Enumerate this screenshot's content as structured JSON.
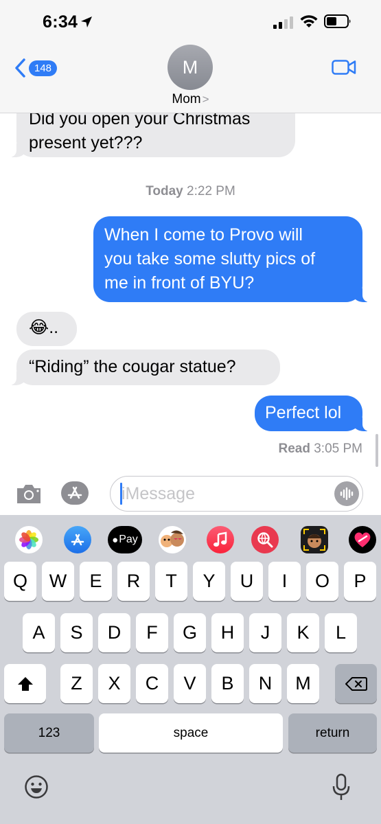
{
  "status_bar": {
    "time": "6:34",
    "icons": [
      "location-arrow-icon",
      "signal-icon",
      "wifi-icon",
      "battery-icon"
    ]
  },
  "header": {
    "back_count": "148",
    "avatar_initial": "M",
    "contact_name": "Mom",
    "contact_chevron": ">",
    "video_icon": "video-camera-icon"
  },
  "messages": [
    {
      "direction": "incoming",
      "text": "Did you open your Christmas\npresent yet???"
    },
    {
      "direction": "incoming",
      "text": "😂.."
    },
    {
      "direction": "incoming",
      "text": "“Riding” the cougar statue?"
    }
  ],
  "outgoing": [
    {
      "direction": "outgoing",
      "text": "When I come to Provo will\nyou take some slutty pics of\nme in front of BYU?"
    },
    {
      "direction": "outgoing",
      "text": "Perfect lol"
    }
  ],
  "timestamp": {
    "day": "Today",
    "time": "2:22 PM"
  },
  "read_receipt": {
    "label": "Read",
    "time": "3:05 PM"
  },
  "input_bar": {
    "placeholder": "iMessage",
    "value": ""
  },
  "app_drawer": [
    "photos-icon",
    "app-store-icon",
    "apple-pay-icon",
    "memoji-stickers-icon",
    "music-icon",
    "search-images-icon",
    "memoji-icon",
    "digital-touch-icon"
  ],
  "apple_pay_label": "Pay",
  "keyboard": {
    "row1": [
      "Q",
      "W",
      "E",
      "R",
      "T",
      "Y",
      "U",
      "I",
      "O",
      "P"
    ],
    "row2": [
      "A",
      "S",
      "D",
      "F",
      "G",
      "H",
      "J",
      "K",
      "L"
    ],
    "row3": [
      "Z",
      "X",
      "C",
      "V",
      "B",
      "N",
      "M"
    ],
    "numbers_key": "123",
    "space_key": "space",
    "return_key": "return"
  },
  "colors": {
    "accent": "#2f7cf6",
    "incoming_bubble": "#e9e9eb",
    "keyboard_bg": "#d1d3d9",
    "meta_text": "#8e8e93"
  }
}
